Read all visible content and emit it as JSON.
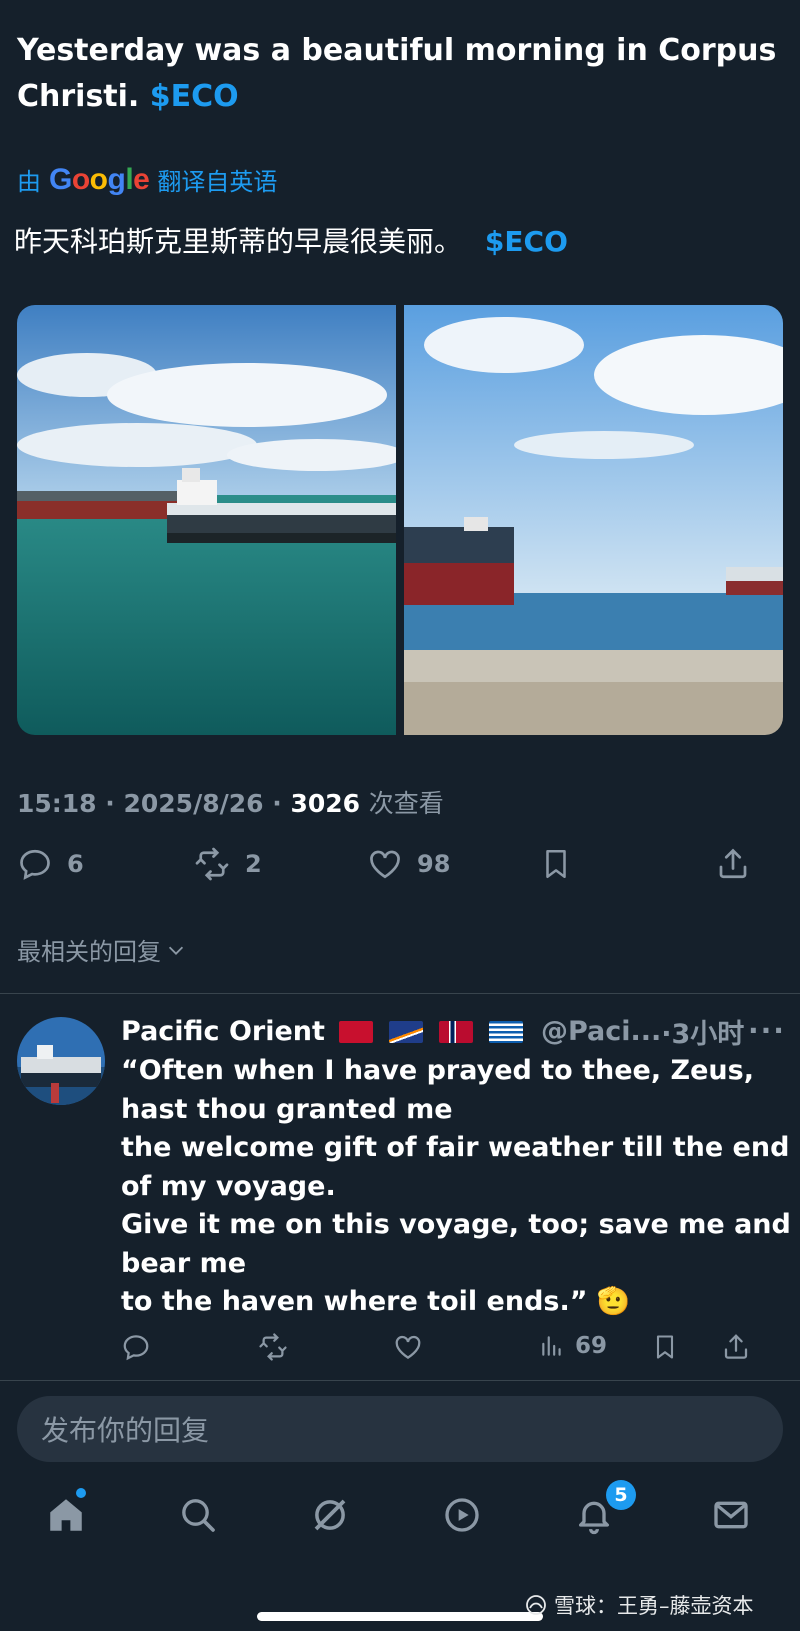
{
  "tweet": {
    "text_main": "Yesterday was a beautiful morning in Corpus Christi.",
    "cashtag": "$ECO",
    "translate_prefix": "由",
    "translate_google": "Google",
    "translate_suffix": "翻译自英语",
    "translated_text": "昨天科珀斯克里斯蒂的早晨很美丽。",
    "translated_cashtag": "$ECO",
    "time": "15:18",
    "date": "2025/8/26",
    "views": "3026",
    "views_label": "次查看",
    "replies": "6",
    "retweets": "2",
    "likes": "98"
  },
  "sort_label": "最相关的回复",
  "reply": {
    "name": "Pacific Orient",
    "flags": [
      "bermuda-flag",
      "marshall-islands-flag",
      "norway-flag",
      "greece-flag"
    ],
    "handle": "@Paci...",
    "time": "·3小时",
    "lines": [
      "“Often when I have prayed to thee, Zeus, hast thou granted me",
      "the welcome gift of fair weather till the end of my voyage.",
      "Give it me on this voyage, too; save me and bear me",
      "to the haven where toil ends.” 🫡"
    ],
    "views": "69"
  },
  "compose_placeholder": "发布你的回复",
  "nav": {
    "notifications_badge": "5"
  },
  "watermark": "雪球：王勇–藤壶资本",
  "colors": {
    "background": "#15202b",
    "accent": "#1d9bf0",
    "muted": "#8b98a5"
  },
  "icons": [
    "reply-icon",
    "retweet-icon",
    "like-icon",
    "bookmark-icon",
    "share-icon",
    "views-icon",
    "home-icon",
    "search-icon",
    "grok-icon",
    "video-icon",
    "bell-icon",
    "mail-icon",
    "chevron-down-icon"
  ]
}
